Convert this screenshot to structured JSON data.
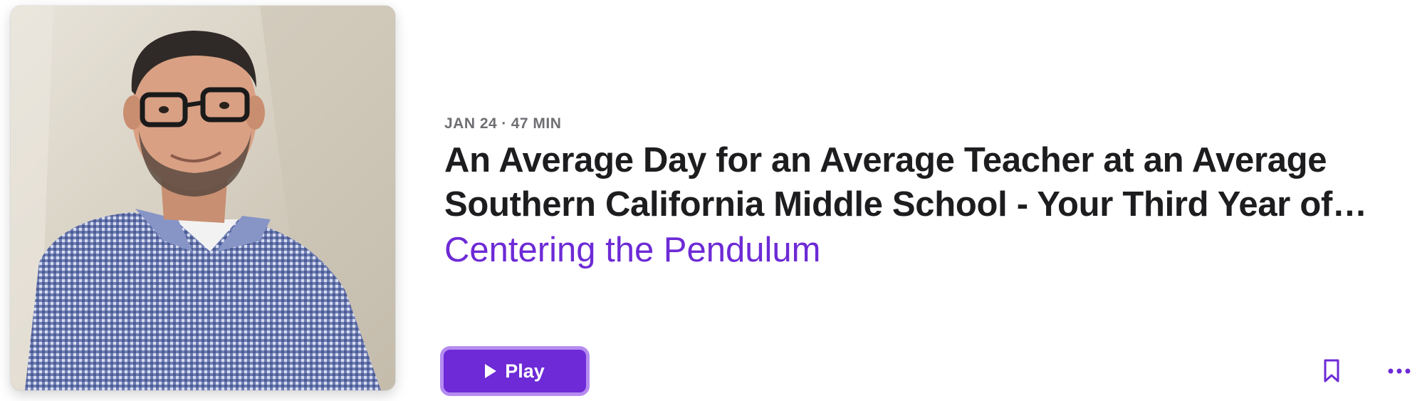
{
  "episode": {
    "date": "JAN 24",
    "separator": "·",
    "duration": "47 MIN",
    "title": "An Average Day for an Average Teacher at an Average Southern California Middle School - Your Third Year of…",
    "show_name": "Centering the Pendulum"
  },
  "actions": {
    "play_label": "Play",
    "play_icon": "play-icon",
    "bookmark_icon": "bookmark-icon",
    "more_icon": "more-ellipsis-icon"
  },
  "colors": {
    "accent": "#6d2ad6",
    "accent_border": "#b58cf0",
    "title": "#1d1d1f",
    "meta": "#6e6e73"
  }
}
